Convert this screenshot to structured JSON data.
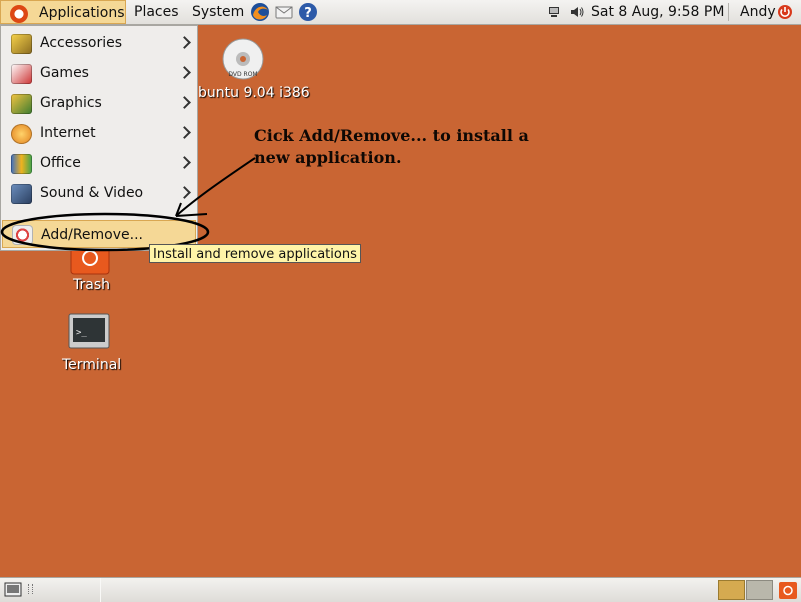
{
  "topbar": {
    "menus": [
      {
        "label": "Applications"
      },
      {
        "label": "Places"
      },
      {
        "label": "System"
      }
    ],
    "clock": "Sat  8 Aug,  9:58 PM",
    "user": "Andy"
  },
  "applications_menu": {
    "items": [
      {
        "label": "Accessories"
      },
      {
        "label": "Games"
      },
      {
        "label": "Graphics"
      },
      {
        "label": "Internet"
      },
      {
        "label": "Office"
      },
      {
        "label": "Sound & Video"
      },
      {
        "label": "Add/Remove..."
      }
    ]
  },
  "desktop": {
    "icons": [
      {
        "label": "buntu 9.04 i386",
        "badge": "DVD ROM"
      },
      {
        "label": "Trash"
      },
      {
        "label": "Terminal"
      }
    ]
  },
  "tooltip": "Install and remove applications",
  "annotation": "Cick Add/Remove... to install a new application.",
  "colors": {
    "desktop_background": "#c96533",
    "menu_highlight": "#f5d896",
    "annotation_text": "#0e0804"
  }
}
